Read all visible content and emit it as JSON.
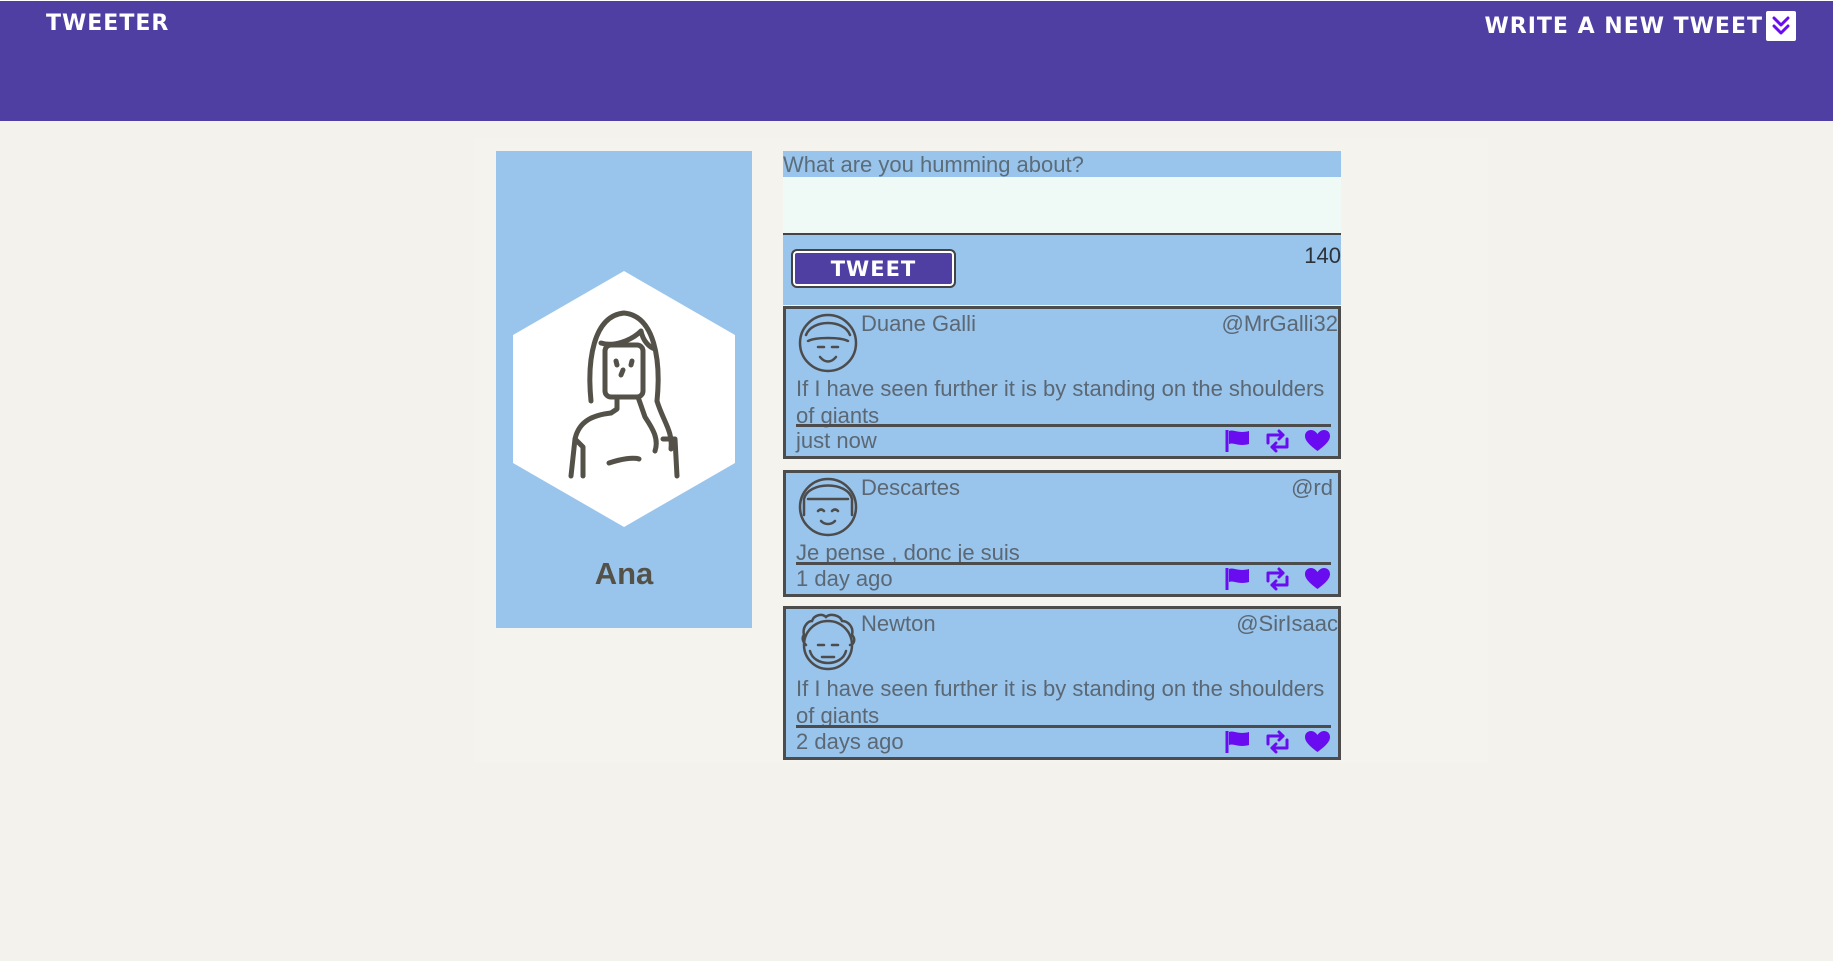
{
  "nav": {
    "brand": "Tweeter",
    "compose_label": "Write a new tweet"
  },
  "profile": {
    "name": "Ana"
  },
  "composer": {
    "prompt": "What are you humming about?",
    "button_label": "Tweet",
    "char_count": "140"
  },
  "tweets": [
    {
      "name": "Duane Galli",
      "handle": "@MrGalli32",
      "body": "If I have seen further it is by standing on the shoulders of giants",
      "time": "just now"
    },
    {
      "name": "Descartes",
      "handle": "@rd",
      "body": "Je pense , donc je suis",
      "time": "1 day ago"
    },
    {
      "name": "Newton",
      "handle": "@SirIsaac",
      "body": "If I have seen further it is by standing on the shoulders of giants",
      "time": "2 days ago"
    }
  ],
  "colors": {
    "nav_bg": "#4f3fa3",
    "card_bg": "#99c4ec",
    "page_bg": "#f4f2ed",
    "icon_accent": "#6a0cf0"
  },
  "icons": {
    "flag": "flag-icon",
    "retweet": "retweet-icon",
    "like": "heart-icon",
    "compose": "double-chevron-down-icon"
  }
}
